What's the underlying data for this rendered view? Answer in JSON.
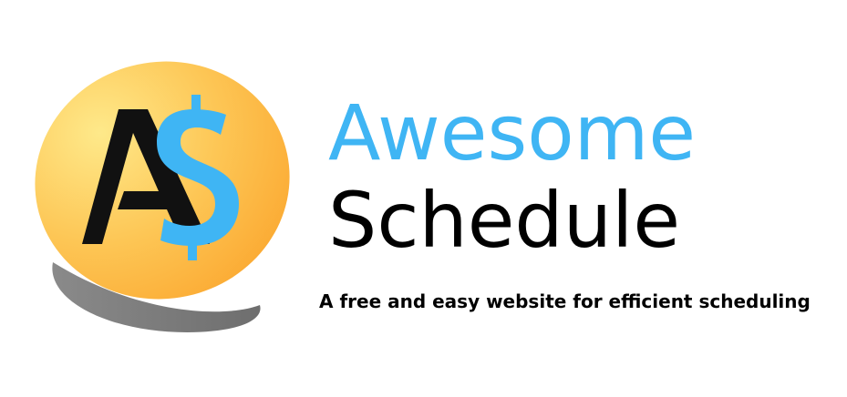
{
  "logo": {
    "monogram_letter_1": "A",
    "monogram_letter_2": "S",
    "colors": {
      "badge_light": "#fde37a",
      "badge_dark": "#fbb03b",
      "shadow": "#7a7a7a",
      "letter_a": "#111111",
      "letter_s": "#3fb5f4"
    }
  },
  "brand": {
    "name_line_1": "Awesome",
    "name_line_2": "Schedule",
    "color_line_1": "#3fb5f4",
    "color_line_2": "#000000"
  },
  "tagline": "A free and easy website for efficient scheduling"
}
